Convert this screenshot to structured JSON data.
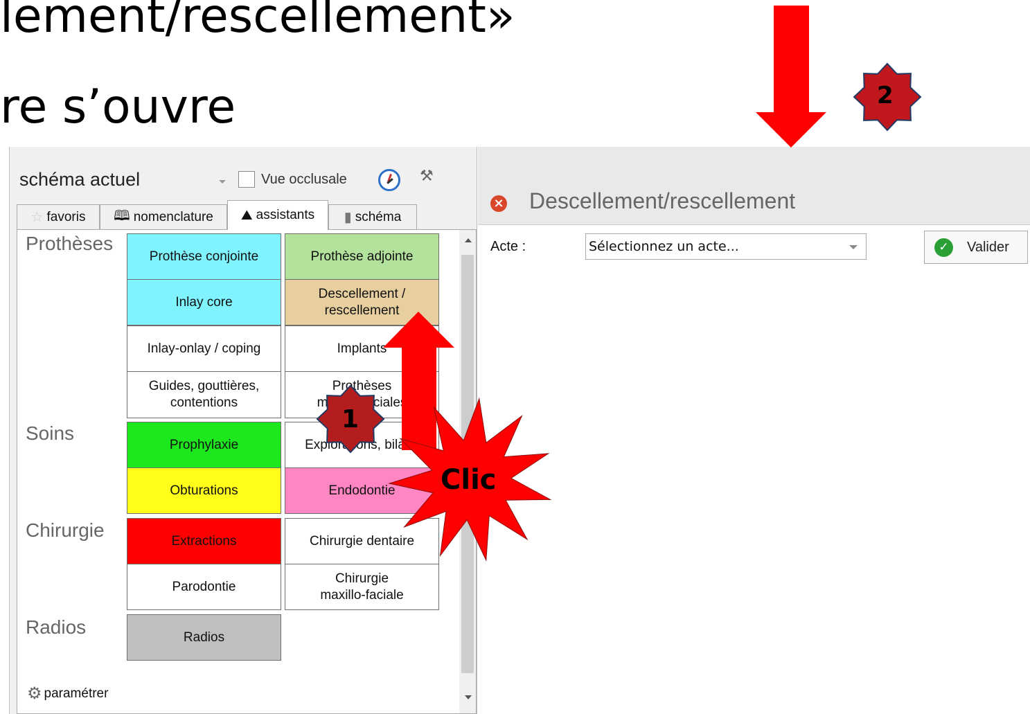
{
  "slide": {
    "line1": "lement/rescellement»",
    "line2": "re s’ouvre"
  },
  "left_panel": {
    "schema_select": {
      "value": "schéma actuel"
    },
    "vue_occlusale": {
      "label": "Vue occlusale",
      "checked": false
    },
    "icons": [
      "clock-icon",
      "tool-icon"
    ],
    "tabs": [
      {
        "label": "favoris",
        "icon": "star-icon"
      },
      {
        "label": "nomenclature",
        "icon": "book-icon"
      },
      {
        "label": "assistants",
        "icon": "wizard-icon",
        "active": true
      },
      {
        "label": "schéma",
        "icon": "tooth-icon"
      }
    ],
    "categories": {
      "protheses": "Prothèses",
      "soins": "Soins",
      "chirurgie": "Chirurgie",
      "radios": "Radios"
    },
    "buttons": {
      "prothese_conjointe": {
        "label": "Prothèse conjointe",
        "color": "#7ff4ff"
      },
      "prothese_adjointe": {
        "label": "Prothèse adjointe",
        "color": "#b3e29c"
      },
      "inlay_core": {
        "label": "Inlay core",
        "color": "#7ff4ff"
      },
      "descellement_line1": "Descellement /",
      "descellement_line2": "rescellement",
      "descellement_color": "#e7cf9f",
      "inlay_onlay": {
        "label": "Inlay-onlay / coping",
        "color": "#ffffff"
      },
      "implants": {
        "label": "Implants",
        "color": "#ffffff"
      },
      "guides_line1": "Guides, gouttières,",
      "guides_line2": "contentions",
      "protheses_mf_line1": "Prothèses",
      "protheses_mf_line2": "maxillo-faciales",
      "prophylaxie": {
        "label": "Prophylaxie",
        "color": "#1de81d"
      },
      "explorations": {
        "label": "Explorations, bilans",
        "color": "#ffffff"
      },
      "obturations": {
        "label": "Obturations",
        "color": "#ffff1a"
      },
      "endodontie": {
        "label": "Endodontie",
        "color": "#ff85c3"
      },
      "extractions": {
        "label": "Extractions",
        "color": "#ff0000"
      },
      "chirurgie_dentaire": {
        "label": "Chirurgie dentaire",
        "color": "#ffffff"
      },
      "parodontie": {
        "label": "Parodontie",
        "color": "#ffffff"
      },
      "chirurgie_mf_line1": "Chirurgie",
      "chirurgie_mf_line2": "maxillo-faciale",
      "radios": {
        "label": "Radios",
        "color": "#bfbfbf"
      }
    },
    "parametrer": "paramétrer"
  },
  "dialog": {
    "title": "Descellement/rescellement",
    "acte_label": "Acte :",
    "acte_select": "Sélectionnez un acte...",
    "valider": "Valider"
  },
  "annotations": {
    "badge1": "1",
    "badge2": "2",
    "clic": "Clic",
    "arrow_color": "#ff0000",
    "star_color": "#ff0000",
    "badge_color": "#b31d1d",
    "badge2_color": "#c0181c",
    "badge_border": "#1f3864"
  }
}
